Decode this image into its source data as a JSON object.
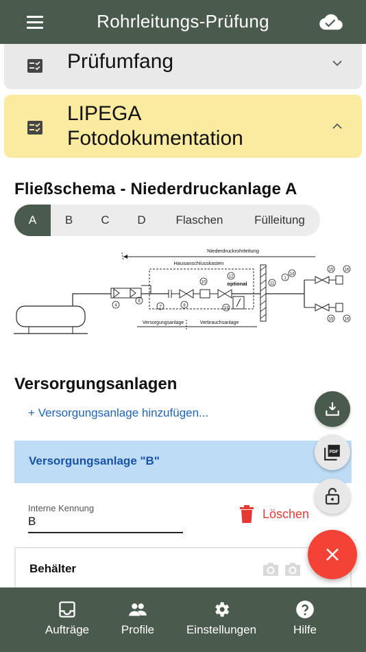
{
  "header": {
    "title": "Rohrleitungs-Prüfung",
    "menu_icon": "menu-icon",
    "sync_icon": "cloud-done-icon"
  },
  "panels": [
    {
      "title": "Prüfumfang",
      "icon": "checklist-icon",
      "state": "collapsed",
      "color": "#e9e9e9"
    },
    {
      "title_line1": "LIPEGA",
      "title_line2": "Fotodokumentation",
      "icon": "checklist-icon",
      "state": "expanded",
      "color": "#fbeba0"
    }
  ],
  "schema": {
    "title": "Fließschema - Niederdruckanlage A",
    "tabs": [
      "A",
      "B",
      "C",
      "D",
      "Flaschen",
      "Fülleitung"
    ],
    "selected_tab": "A",
    "diagram_labels": {
      "top": "Niederdruckrohrleitung",
      "box": "Hausanschlusskasten",
      "optional": "optional",
      "left_bottom": "Versorgungsanlage",
      "right_bottom": "Verbrauchsanlage",
      "numbers": [
        "4",
        "6",
        "7",
        "8",
        "10",
        "12",
        "13",
        "11",
        "1",
        "14",
        "15",
        "16",
        "15",
        "16"
      ]
    }
  },
  "versorgung": {
    "title": "Versorgungsanlagen",
    "add_link": "+ Versorgungsanlage hinzufügen...",
    "item_title": "Versorgungsanlage \"B\"",
    "field_label": "Interne Kennung",
    "field_value": "B",
    "delete_label": "Löschen",
    "card_title": "Behälter"
  },
  "fabs": [
    "download-icon",
    "pdf-icon",
    "lock-open-icon",
    "close-icon"
  ],
  "colors": {
    "primary": "#4a5a4c",
    "accent_red": "#f44336",
    "link_blue": "#1e63b8",
    "highlight_yellow": "#fbeba0",
    "subheader_blue": "#bedcf6"
  },
  "bottom_nav": [
    {
      "label": "Aufträge",
      "icon": "inbox-icon"
    },
    {
      "label": "Profile",
      "icon": "people-icon"
    },
    {
      "label": "Einstellungen",
      "icon": "settings-icon"
    },
    {
      "label": "Hilfe",
      "icon": "help-icon"
    }
  ]
}
